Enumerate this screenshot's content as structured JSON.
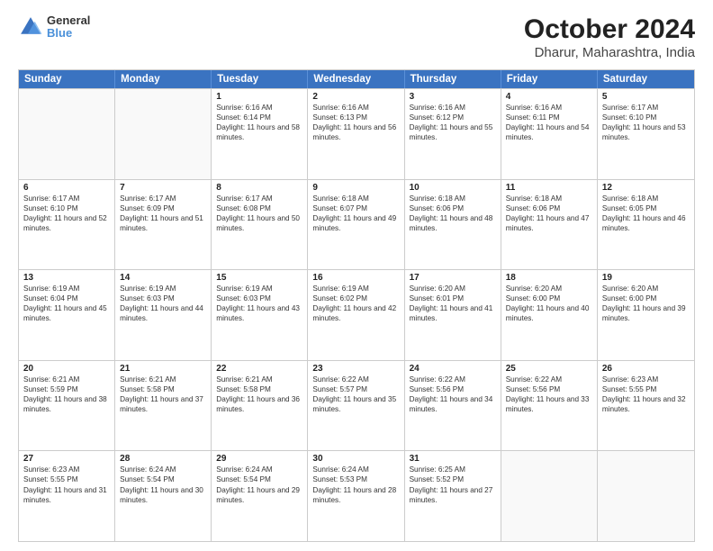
{
  "header": {
    "logo_general": "General",
    "logo_blue": "Blue",
    "title": "October 2024",
    "subtitle": "Dharur, Maharashtra, India"
  },
  "weekdays": [
    "Sunday",
    "Monday",
    "Tuesday",
    "Wednesday",
    "Thursday",
    "Friday",
    "Saturday"
  ],
  "weeks": [
    [
      {
        "day": "",
        "sunrise": "",
        "sunset": "",
        "daylight": ""
      },
      {
        "day": "",
        "sunrise": "",
        "sunset": "",
        "daylight": ""
      },
      {
        "day": "1",
        "sunrise": "Sunrise: 6:16 AM",
        "sunset": "Sunset: 6:14 PM",
        "daylight": "Daylight: 11 hours and 58 minutes."
      },
      {
        "day": "2",
        "sunrise": "Sunrise: 6:16 AM",
        "sunset": "Sunset: 6:13 PM",
        "daylight": "Daylight: 11 hours and 56 minutes."
      },
      {
        "day": "3",
        "sunrise": "Sunrise: 6:16 AM",
        "sunset": "Sunset: 6:12 PM",
        "daylight": "Daylight: 11 hours and 55 minutes."
      },
      {
        "day": "4",
        "sunrise": "Sunrise: 6:16 AM",
        "sunset": "Sunset: 6:11 PM",
        "daylight": "Daylight: 11 hours and 54 minutes."
      },
      {
        "day": "5",
        "sunrise": "Sunrise: 6:17 AM",
        "sunset": "Sunset: 6:10 PM",
        "daylight": "Daylight: 11 hours and 53 minutes."
      }
    ],
    [
      {
        "day": "6",
        "sunrise": "Sunrise: 6:17 AM",
        "sunset": "Sunset: 6:10 PM",
        "daylight": "Daylight: 11 hours and 52 minutes."
      },
      {
        "day": "7",
        "sunrise": "Sunrise: 6:17 AM",
        "sunset": "Sunset: 6:09 PM",
        "daylight": "Daylight: 11 hours and 51 minutes."
      },
      {
        "day": "8",
        "sunrise": "Sunrise: 6:17 AM",
        "sunset": "Sunset: 6:08 PM",
        "daylight": "Daylight: 11 hours and 50 minutes."
      },
      {
        "day": "9",
        "sunrise": "Sunrise: 6:18 AM",
        "sunset": "Sunset: 6:07 PM",
        "daylight": "Daylight: 11 hours and 49 minutes."
      },
      {
        "day": "10",
        "sunrise": "Sunrise: 6:18 AM",
        "sunset": "Sunset: 6:06 PM",
        "daylight": "Daylight: 11 hours and 48 minutes."
      },
      {
        "day": "11",
        "sunrise": "Sunrise: 6:18 AM",
        "sunset": "Sunset: 6:06 PM",
        "daylight": "Daylight: 11 hours and 47 minutes."
      },
      {
        "day": "12",
        "sunrise": "Sunrise: 6:18 AM",
        "sunset": "Sunset: 6:05 PM",
        "daylight": "Daylight: 11 hours and 46 minutes."
      }
    ],
    [
      {
        "day": "13",
        "sunrise": "Sunrise: 6:19 AM",
        "sunset": "Sunset: 6:04 PM",
        "daylight": "Daylight: 11 hours and 45 minutes."
      },
      {
        "day": "14",
        "sunrise": "Sunrise: 6:19 AM",
        "sunset": "Sunset: 6:03 PM",
        "daylight": "Daylight: 11 hours and 44 minutes."
      },
      {
        "day": "15",
        "sunrise": "Sunrise: 6:19 AM",
        "sunset": "Sunset: 6:03 PM",
        "daylight": "Daylight: 11 hours and 43 minutes."
      },
      {
        "day": "16",
        "sunrise": "Sunrise: 6:19 AM",
        "sunset": "Sunset: 6:02 PM",
        "daylight": "Daylight: 11 hours and 42 minutes."
      },
      {
        "day": "17",
        "sunrise": "Sunrise: 6:20 AM",
        "sunset": "Sunset: 6:01 PM",
        "daylight": "Daylight: 11 hours and 41 minutes."
      },
      {
        "day": "18",
        "sunrise": "Sunrise: 6:20 AM",
        "sunset": "Sunset: 6:00 PM",
        "daylight": "Daylight: 11 hours and 40 minutes."
      },
      {
        "day": "19",
        "sunrise": "Sunrise: 6:20 AM",
        "sunset": "Sunset: 6:00 PM",
        "daylight": "Daylight: 11 hours and 39 minutes."
      }
    ],
    [
      {
        "day": "20",
        "sunrise": "Sunrise: 6:21 AM",
        "sunset": "Sunset: 5:59 PM",
        "daylight": "Daylight: 11 hours and 38 minutes."
      },
      {
        "day": "21",
        "sunrise": "Sunrise: 6:21 AM",
        "sunset": "Sunset: 5:58 PM",
        "daylight": "Daylight: 11 hours and 37 minutes."
      },
      {
        "day": "22",
        "sunrise": "Sunrise: 6:21 AM",
        "sunset": "Sunset: 5:58 PM",
        "daylight": "Daylight: 11 hours and 36 minutes."
      },
      {
        "day": "23",
        "sunrise": "Sunrise: 6:22 AM",
        "sunset": "Sunset: 5:57 PM",
        "daylight": "Daylight: 11 hours and 35 minutes."
      },
      {
        "day": "24",
        "sunrise": "Sunrise: 6:22 AM",
        "sunset": "Sunset: 5:56 PM",
        "daylight": "Daylight: 11 hours and 34 minutes."
      },
      {
        "day": "25",
        "sunrise": "Sunrise: 6:22 AM",
        "sunset": "Sunset: 5:56 PM",
        "daylight": "Daylight: 11 hours and 33 minutes."
      },
      {
        "day": "26",
        "sunrise": "Sunrise: 6:23 AM",
        "sunset": "Sunset: 5:55 PM",
        "daylight": "Daylight: 11 hours and 32 minutes."
      }
    ],
    [
      {
        "day": "27",
        "sunrise": "Sunrise: 6:23 AM",
        "sunset": "Sunset: 5:55 PM",
        "daylight": "Daylight: 11 hours and 31 minutes."
      },
      {
        "day": "28",
        "sunrise": "Sunrise: 6:24 AM",
        "sunset": "Sunset: 5:54 PM",
        "daylight": "Daylight: 11 hours and 30 minutes."
      },
      {
        "day": "29",
        "sunrise": "Sunrise: 6:24 AM",
        "sunset": "Sunset: 5:54 PM",
        "daylight": "Daylight: 11 hours and 29 minutes."
      },
      {
        "day": "30",
        "sunrise": "Sunrise: 6:24 AM",
        "sunset": "Sunset: 5:53 PM",
        "daylight": "Daylight: 11 hours and 28 minutes."
      },
      {
        "day": "31",
        "sunrise": "Sunrise: 6:25 AM",
        "sunset": "Sunset: 5:52 PM",
        "daylight": "Daylight: 11 hours and 27 minutes."
      },
      {
        "day": "",
        "sunrise": "",
        "sunset": "",
        "daylight": ""
      },
      {
        "day": "",
        "sunrise": "",
        "sunset": "",
        "daylight": ""
      }
    ]
  ]
}
